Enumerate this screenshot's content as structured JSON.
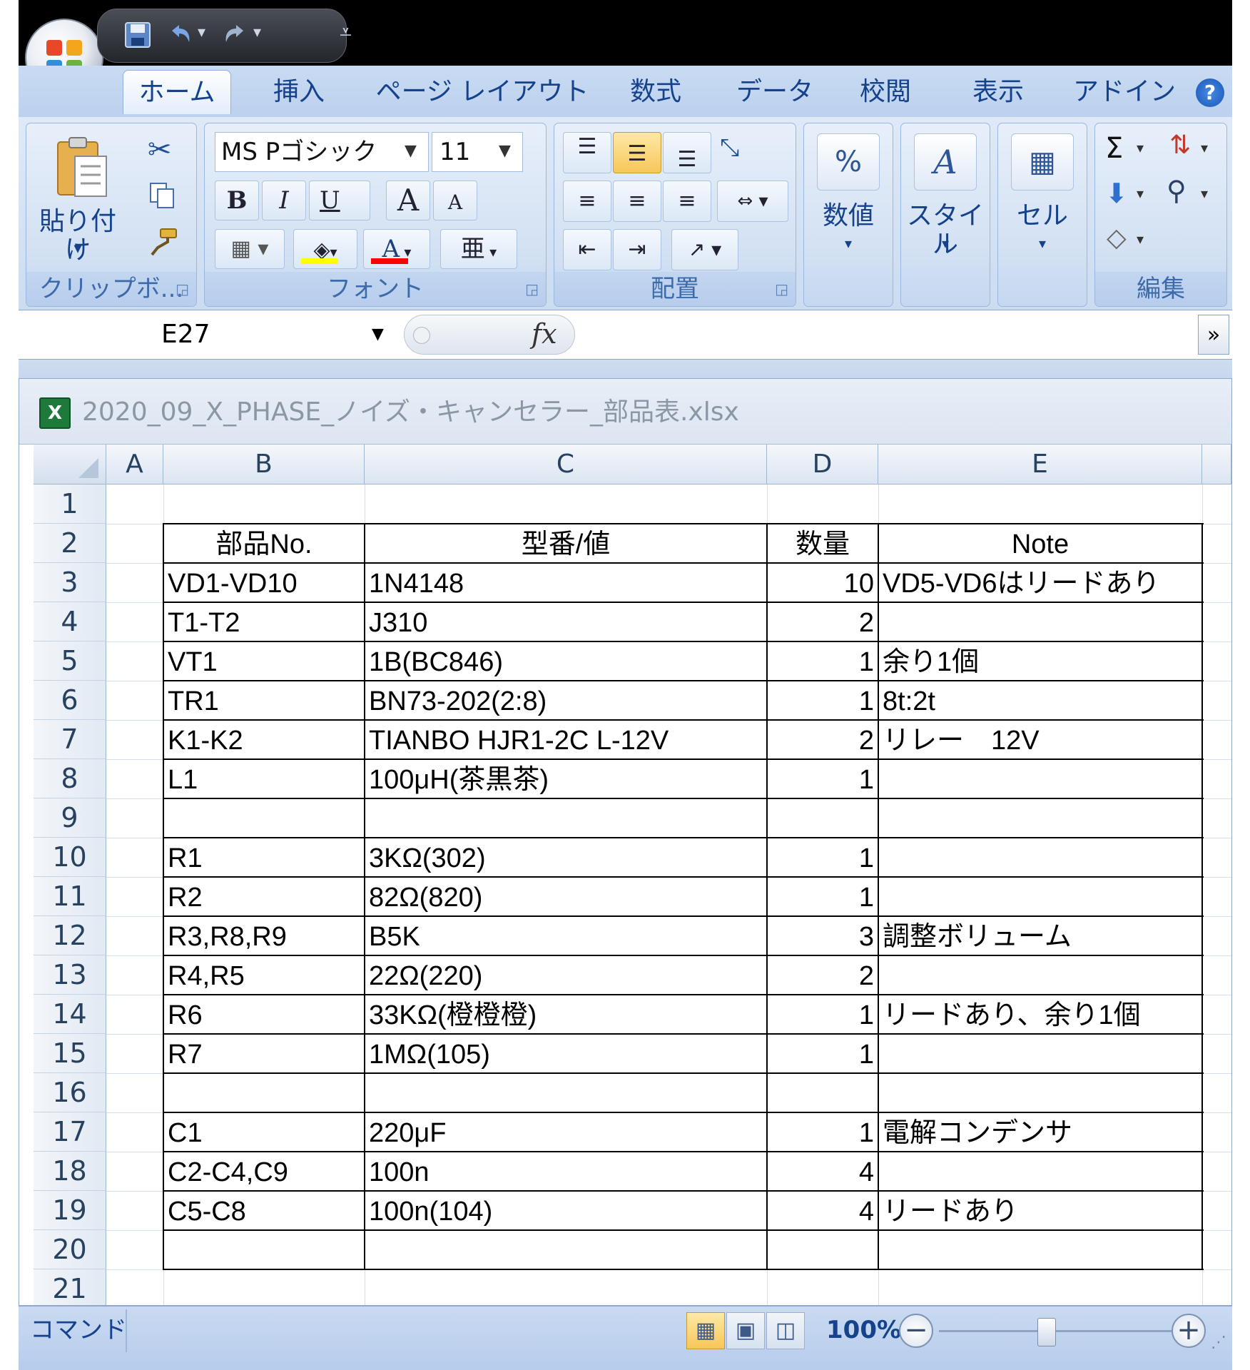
{
  "qat": {
    "save_icon": "save-icon",
    "undo_icon": "undo-icon",
    "redo_icon": "redo-icon",
    "dropdown": "▾",
    "customize": "⩡"
  },
  "tabs": [
    "ホーム",
    "挿入",
    "ページ レイアウト",
    "数式",
    "データ",
    "校閲",
    "表示",
    "アドイン"
  ],
  "ribbon": {
    "clipboard": {
      "paste": "貼り付け",
      "label": "クリップボ..."
    },
    "font": {
      "name": "MS Pゴシック",
      "size": "11",
      "bold": "B",
      "italic": "I",
      "underline": "U",
      "grow": "A",
      "shrink": "A",
      "color_a": "A",
      "phonetic": "亜",
      "label": "フォント"
    },
    "alignment": {
      "label": "配置"
    },
    "number": {
      "symbol": "%",
      "label": "数値"
    },
    "styles": {
      "label": "スタイル"
    },
    "cells": {
      "label": "セル"
    },
    "editing": {
      "sum": "Σ",
      "label": "編集"
    }
  },
  "formula_bar": {
    "name_box": "E27",
    "fx": "fx",
    "value": ""
  },
  "workbook": {
    "title": "2020_09_X_PHASE_ノイズ・キャンセラー_部品表.xlsx",
    "icon_text": "X"
  },
  "columns": [
    "A",
    "B",
    "C",
    "D",
    "E"
  ],
  "rows": [
    {
      "n": "1",
      "b": "",
      "c": "",
      "d": "",
      "e": ""
    },
    {
      "n": "2",
      "b": "部品No.",
      "c": "型番/値",
      "d": "数量",
      "e": "Note"
    },
    {
      "n": "3",
      "b": "VD1-VD10",
      "c": "1N4148",
      "d": "10",
      "e": "VD5-VD6はリードあり"
    },
    {
      "n": "4",
      "b": "T1-T2",
      "c": "J310",
      "d": "2",
      "e": ""
    },
    {
      "n": "5",
      "b": "VT1",
      "c": "1B(BC846)",
      "d": "1",
      "e": "余り1個"
    },
    {
      "n": "6",
      "b": "TR1",
      "c": "BN73-202(2:8)",
      "d": "1",
      "e": "8t:2t"
    },
    {
      "n": "7",
      "b": "K1-K2",
      "c": "TIANBO HJR1-2C L-12V",
      "d": "2",
      "e": "リレー　12V"
    },
    {
      "n": "8",
      "b": "L1",
      "c": "100μH(茶黒茶)",
      "d": "1",
      "e": ""
    },
    {
      "n": "9",
      "b": "",
      "c": "",
      "d": "",
      "e": ""
    },
    {
      "n": "10",
      "b": "R1",
      "c": "3KΩ(302)",
      "d": "1",
      "e": ""
    },
    {
      "n": "11",
      "b": "R2",
      "c": "82Ω(820)",
      "d": "1",
      "e": ""
    },
    {
      "n": "12",
      "b": "R3,R8,R9",
      "c": "B5K",
      "d": "3",
      "e": "調整ボリューム"
    },
    {
      "n": "13",
      "b": "R4,R5",
      "c": "22Ω(220)",
      "d": "2",
      "e": ""
    },
    {
      "n": "14",
      "b": "R6",
      "c": "33KΩ(橙橙橙)",
      "d": "1",
      "e": "リードあり、余り1個"
    },
    {
      "n": "15",
      "b": "R7",
      "c": "1MΩ(105)",
      "d": "1",
      "e": ""
    },
    {
      "n": "16",
      "b": "",
      "c": "",
      "d": "",
      "e": ""
    },
    {
      "n": "17",
      "b": "C1",
      "c": "220μF",
      "d": "1",
      "e": "電解コンデンサ"
    },
    {
      "n": "18",
      "b": "C2-C4,C9",
      "c": "100n",
      "d": "4",
      "e": ""
    },
    {
      "n": "19",
      "b": "C5-C8",
      "c": "100n(104)",
      "d": "4",
      "e": "リードあり"
    },
    {
      "n": "20",
      "b": "",
      "c": "",
      "d": "",
      "e": ""
    },
    {
      "n": "21",
      "b": "",
      "c": "",
      "d": "",
      "e": ""
    }
  ],
  "status": {
    "mode": "コマンド",
    "zoom": "100%",
    "minus": "−",
    "plus": "+"
  }
}
